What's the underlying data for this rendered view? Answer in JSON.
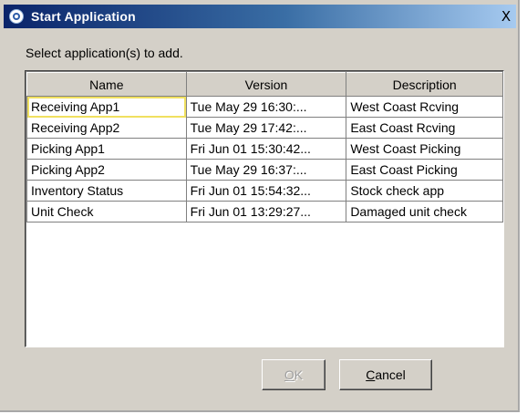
{
  "window": {
    "title": "Start Application",
    "close_label": "X"
  },
  "prompt": "Select application(s) to add.",
  "table": {
    "columns": [
      "Name",
      "Version",
      "Description"
    ],
    "rows": [
      [
        "Receiving App1",
        "Tue May 29 16:30:...",
        "West Coast Rcving"
      ],
      [
        "Receiving App2",
        "Tue May 29 17:42:...",
        "East Coast Rcving"
      ],
      [
        "Picking App1",
        "Fri Jun 01 15:30:42...",
        "West Coast Picking"
      ],
      [
        "Picking App2",
        "Tue May 29 16:37:...",
        "East Coast Picking"
      ],
      [
        "Inventory Status",
        "Fri Jun 01 15:54:32...",
        "Stock check app"
      ],
      [
        "Unit Check",
        "Fri Jun 01 13:29:27...",
        "Damaged unit check"
      ]
    ]
  },
  "buttons": {
    "ok_mnemonic": "O",
    "ok_rest": "K",
    "ok_enabled": false,
    "cancel_mnemonic": "C",
    "cancel_rest": "ancel"
  }
}
